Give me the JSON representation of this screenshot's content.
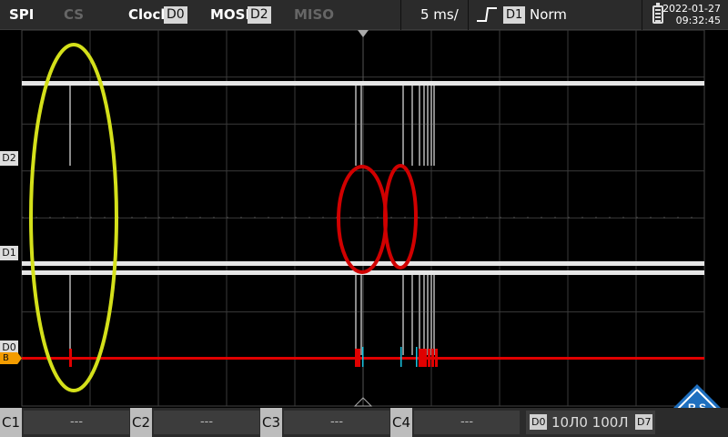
{
  "topbar": {
    "protocol": "SPI",
    "cs_label": "CS",
    "clock_label": "Clock",
    "clock_src": "D0",
    "mosi_label": "MOSI",
    "mosi_src": "D2",
    "miso_label": "MISO",
    "timebase": "5 ms/",
    "trigger_source": "D1",
    "trigger_mode": "Norm",
    "date": "2022-01-27",
    "time": "09:32:45"
  },
  "channel_labels": [
    "D2",
    "D1",
    "D0",
    "B"
  ],
  "bottombar": {
    "channels": [
      {
        "label": "C1",
        "value": "---"
      },
      {
        "label": "C2",
        "value": "---"
      },
      {
        "label": "C3",
        "value": "---"
      },
      {
        "label": "C4",
        "value": "---"
      }
    ],
    "logic_start": "D0",
    "logic_text": "10Л0  100Л",
    "logic_end": "D7"
  },
  "colors": {
    "bus_red": "#e00000",
    "annotation_red": "#d00000",
    "annotation_yellow": "#d4e01a",
    "digital_white": "#e6e6e6",
    "cyan": "#19c3e0",
    "rs_blue": "#1e6fbf"
  },
  "icons": [
    "battery-icon",
    "trigger-edge-icon",
    "rs-logo-icon"
  ]
}
